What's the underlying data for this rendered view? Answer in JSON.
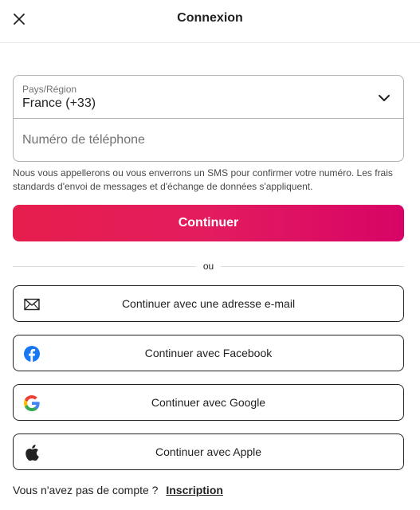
{
  "header": {
    "title": "Connexion",
    "close_icon": "close-icon"
  },
  "phone_form": {
    "country_label": "Pays/Région",
    "country_value": "France (+33)",
    "chevron_icon": "chevron-down-icon",
    "phone_placeholder": "Numéro de téléphone",
    "phone_value": ""
  },
  "hint": "Nous vous appellerons ou vous enverrons un SMS pour confirmer votre numéro. Les frais standards d'envoi de messages et d'échange de données s'appliquent.",
  "continue_label": "Continuer",
  "divider_label": "ou",
  "social": {
    "email": {
      "label": "Continuer avec une adresse e-mail",
      "icon": "envelope-icon"
    },
    "facebook": {
      "label": "Continuer avec Facebook",
      "icon": "facebook-icon"
    },
    "google": {
      "label": "Continuer avec Google",
      "icon": "google-icon"
    },
    "apple": {
      "label": "Continuer avec Apple",
      "icon": "apple-icon"
    }
  },
  "footer": {
    "question": "Vous n'avez pas de compte ?",
    "signup_label": "Inscription"
  },
  "colors": {
    "brand_start": "#e61e4d",
    "brand_end": "#d70466",
    "facebook": "#1877f2"
  }
}
